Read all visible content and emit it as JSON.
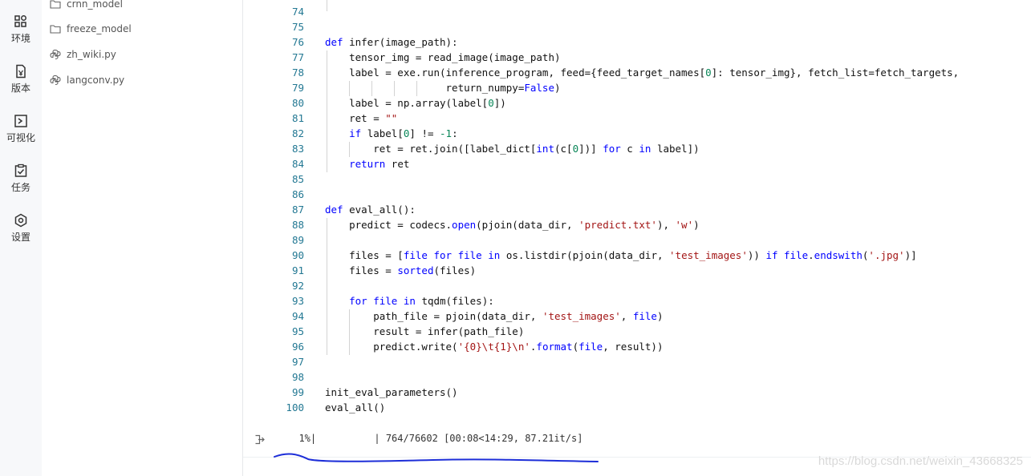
{
  "rail": {
    "items": [
      {
        "label": "环境",
        "icon": "environment-icon"
      },
      {
        "label": "版本",
        "icon": "version-icon"
      },
      {
        "label": "可视化",
        "icon": "visualization-icon"
      },
      {
        "label": "任务",
        "icon": "task-icon"
      },
      {
        "label": "设置",
        "icon": "settings-icon"
      }
    ]
  },
  "files": [
    {
      "name": "crnn_model",
      "icon": "folder-icon"
    },
    {
      "name": "freeze_model",
      "icon": "folder-icon"
    },
    {
      "name": "zh_wiki.py",
      "icon": "python-file-icon"
    },
    {
      "name": "langconv.py",
      "icon": "python-file-icon"
    }
  ],
  "code": {
    "lines": [
      {
        "num": "74",
        "text": ""
      },
      {
        "num": "75",
        "text": ""
      },
      {
        "num": "76",
        "text": "def infer(image_path):"
      },
      {
        "num": "77",
        "text": "    tensor_img = read_image(image_path)"
      },
      {
        "num": "78",
        "text": "    label = exe.run(inference_program, feed={feed_target_names[0]: tensor_img}, fetch_list=fetch_targets,"
      },
      {
        "num": "79",
        "text": "                    return_numpy=False)"
      },
      {
        "num": "80",
        "text": "    label = np.array(label[0])"
      },
      {
        "num": "81",
        "text": "    ret = \"\""
      },
      {
        "num": "82",
        "text": "    if label[0] != -1:"
      },
      {
        "num": "83",
        "text": "        ret = ret.join([label_dict[int(c[0])] for c in label])"
      },
      {
        "num": "84",
        "text": "    return ret"
      },
      {
        "num": "85",
        "text": ""
      },
      {
        "num": "86",
        "text": ""
      },
      {
        "num": "87",
        "text": "def eval_all():"
      },
      {
        "num": "88",
        "text": "    predict = codecs.open(pjoin(data_dir, 'predict.txt'), 'w')"
      },
      {
        "num": "89",
        "text": ""
      },
      {
        "num": "90",
        "text": "    files = [file for file in os.listdir(pjoin(data_dir, 'test_images')) if file.endswith('.jpg')]"
      },
      {
        "num": "91",
        "text": "    files = sorted(files)"
      },
      {
        "num": "92",
        "text": ""
      },
      {
        "num": "93",
        "text": "    for file in tqdm(files):"
      },
      {
        "num": "94",
        "text": "        path_file = pjoin(data_dir, 'test_images', file)"
      },
      {
        "num": "95",
        "text": "        result = infer(path_file)"
      },
      {
        "num": "96",
        "text": "        predict.write('{0}\\t{1}\\n'.format(file, result))"
      },
      {
        "num": "97",
        "text": ""
      },
      {
        "num": "98",
        "text": ""
      },
      {
        "num": "99",
        "text": "init_eval_parameters()"
      },
      {
        "num": "100",
        "text": "eval_all()"
      }
    ]
  },
  "output": {
    "text": "  1%|          | 764/76602 [00:08<14:29, 87.21it/s]",
    "icon": "output-arrow-icon"
  },
  "watermark": "https://blog.csdn.net/weixin_43668325",
  "colors": {
    "keyword": "#0000ff",
    "string": "#a31515",
    "number": "#098658",
    "line_number": "#237893"
  }
}
